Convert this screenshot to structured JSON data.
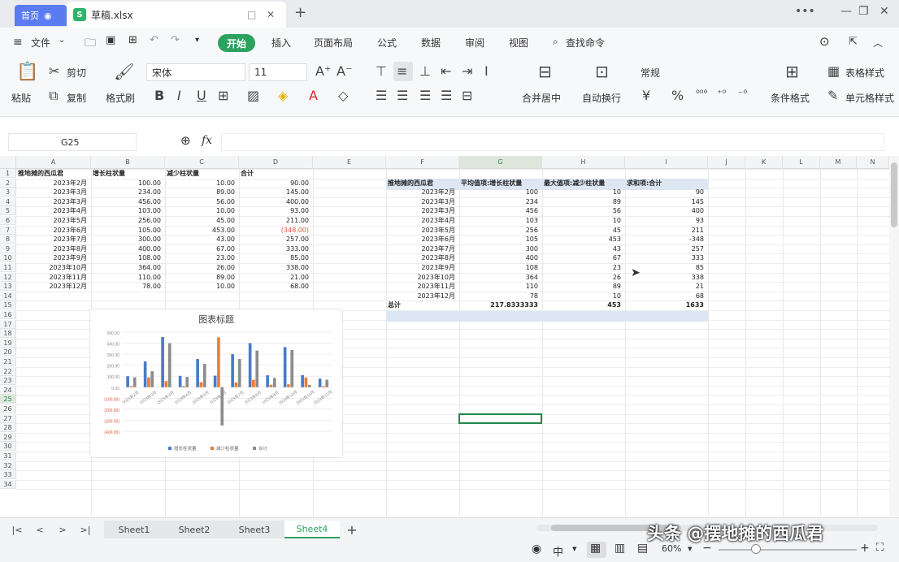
{
  "titlebar": {
    "home_tab": "首页",
    "file_tab": "草稿.xlsx",
    "new_tab": "+"
  },
  "menu": {
    "file": "文件",
    "items": [
      "开始",
      "插入",
      "页面布局",
      "公式",
      "数据",
      "审阅",
      "视图"
    ],
    "search": "查找命令"
  },
  "ribbon": {
    "paste": "粘贴",
    "cut": "剪切",
    "copy": "复制",
    "format_painter": "格式刷",
    "font": "宋体",
    "size": "11",
    "merge": "合并居中",
    "wrap": "自动换行",
    "number_format": "常规",
    "cond_format": "条件格式",
    "table_style": "表格样式",
    "cell_style": "单元格样式"
  },
  "formula_bar": {
    "cellref": "G25",
    "fx": "fx",
    "value": ""
  },
  "columns": [
    "A",
    "B",
    "C",
    "D",
    "E",
    "F",
    "G",
    "H",
    "I",
    "J",
    "K",
    "L",
    "M",
    "N"
  ],
  "rows": [
    "1",
    "2",
    "3",
    "4",
    "5",
    "6",
    "7",
    "8",
    "9",
    "10",
    "11",
    "12",
    "13",
    "14",
    "15",
    "16",
    "17",
    "18",
    "19",
    "20",
    "21",
    "22",
    "23",
    "24",
    "25",
    "26",
    "27",
    "28",
    "29",
    "30",
    "31",
    "32",
    "33",
    "34"
  ],
  "source": {
    "headers": [
      "推地摊的西瓜君",
      "增长柱状量",
      "减少柱状量",
      "合计"
    ],
    "rows": [
      [
        "2023年2月",
        "100.00",
        "10.00",
        "90.00"
      ],
      [
        "2023年3月",
        "234.00",
        "89.00",
        "145.00"
      ],
      [
        "2023年3月",
        "456.00",
        "56.00",
        "400.00"
      ],
      [
        "2023年4月",
        "103.00",
        "10.00",
        "93.00"
      ],
      [
        "2023年5月",
        "256.00",
        "45.00",
        "211.00"
      ],
      [
        "2023年6月",
        "105.00",
        "453.00",
        "(348.00)"
      ],
      [
        "2023年7月",
        "300.00",
        "43.00",
        "257.00"
      ],
      [
        "2023年8月",
        "400.00",
        "67.00",
        "333.00"
      ],
      [
        "2023年9月",
        "108.00",
        "23.00",
        "85.00"
      ],
      [
        "2023年10月",
        "364.00",
        "26.00",
        "338.00"
      ],
      [
        "2023年11月",
        "110.00",
        "89.00",
        "21.00"
      ],
      [
        "2023年12月",
        "78.00",
        "10.00",
        "68.00"
      ]
    ]
  },
  "pivot": {
    "headers": [
      "推地摊的西瓜君",
      "平均值项:增长柱状量",
      "最大值项:减少柱状量",
      "求和项:合计"
    ],
    "rows": [
      [
        "2023年2月",
        "100",
        "10",
        "90"
      ],
      [
        "2023年3月",
        "234",
        "89",
        "145"
      ],
      [
        "2023年3月",
        "456",
        "56",
        "400"
      ],
      [
        "2023年4月",
        "103",
        "10",
        "93"
      ],
      [
        "2023年5月",
        "256",
        "45",
        "211"
      ],
      [
        "2023年6月",
        "105",
        "453",
        "-348"
      ],
      [
        "2023年7月",
        "300",
        "43",
        "257"
      ],
      [
        "2023年8月",
        "400",
        "67",
        "333"
      ],
      [
        "2023年9月",
        "108",
        "23",
        "85"
      ],
      [
        "2023年10月",
        "364",
        "26",
        "338"
      ],
      [
        "2023年11月",
        "110",
        "89",
        "21"
      ],
      [
        "2023年12月",
        "78",
        "10",
        "68"
      ]
    ],
    "total": [
      "总计",
      "217.8333333",
      "453",
      "1633"
    ]
  },
  "chart_data": {
    "type": "bar",
    "title": "图表标题",
    "categories": [
      "2023年2月",
      "2023年3月",
      "2023年3月",
      "2023年4月",
      "2023年5月",
      "2023年6月",
      "2023年7月",
      "2023年8月",
      "2023年9月",
      "2023年10月",
      "2023年11月",
      "2023年12月"
    ],
    "series": [
      {
        "name": "增长柱状量",
        "color": "#4a7bc8",
        "values": [
          100,
          234,
          456,
          103,
          256,
          105,
          300,
          400,
          108,
          364,
          110,
          78
        ]
      },
      {
        "name": "减少柱状量",
        "color": "#ed7d31",
        "values": [
          10,
          89,
          56,
          10,
          45,
          453,
          43,
          67,
          23,
          26,
          89,
          10
        ]
      },
      {
        "name": "合计",
        "color": "#8c8c8c",
        "values": [
          90,
          145,
          400,
          93,
          211,
          -348,
          257,
          333,
          85,
          338,
          21,
          68
        ]
      }
    ],
    "yticks": [
      "500.00",
      "400.00",
      "300.00",
      "200.00",
      "100.00",
      "0.00",
      "(100.00)",
      "(200.00)",
      "(300.00)",
      "(400.00)"
    ],
    "ylim": [
      -400,
      500
    ],
    "legend": "bottom"
  },
  "sheets": [
    "Sheet1",
    "Sheet2",
    "Sheet3",
    "Sheet4"
  ],
  "status": {
    "zoom": "60%",
    "ime": "中"
  },
  "watermark": "头条 @摆地摊的西瓜君"
}
